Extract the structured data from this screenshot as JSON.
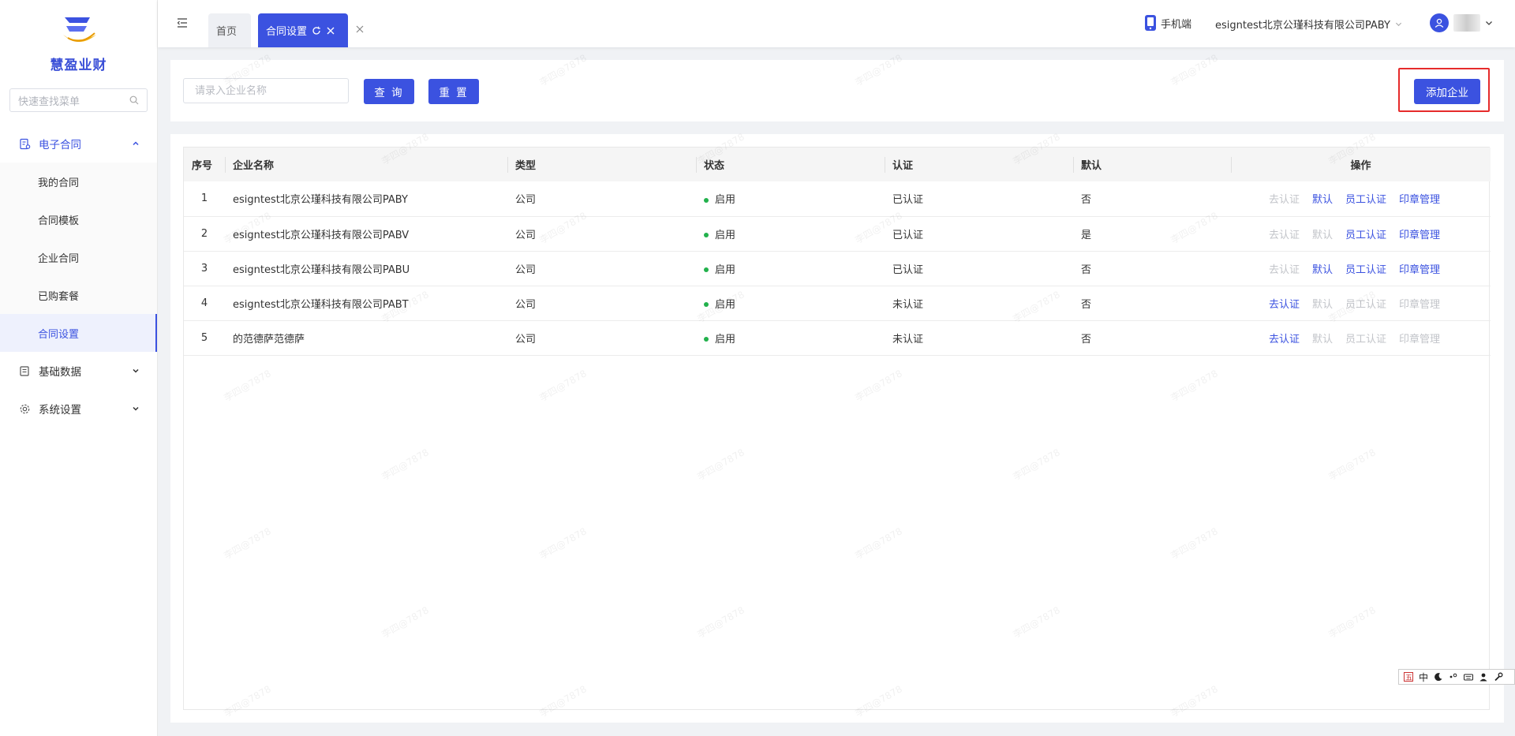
{
  "app": {
    "name": "慧盈业财"
  },
  "sidebar": {
    "search_placeholder": "快速查找菜单",
    "groups": [
      {
        "label": "电子合同",
        "icon": "contract-icon",
        "expanded": true,
        "items": [
          {
            "label": "我的合同"
          },
          {
            "label": "合同模板"
          },
          {
            "label": "企业合同"
          },
          {
            "label": "已购套餐"
          },
          {
            "label": "合同设置",
            "active": true
          }
        ]
      },
      {
        "label": "基础数据",
        "icon": "database-icon",
        "expanded": false
      },
      {
        "label": "系统设置",
        "icon": "gear-icon",
        "expanded": false
      }
    ]
  },
  "header": {
    "tabs": [
      {
        "label": "首页"
      },
      {
        "label": "合同设置",
        "active": true
      }
    ],
    "mobile_label": "手机端",
    "company": "esigntest北京公瑾科技有限公司PABY"
  },
  "search": {
    "placeholder": "请录入企业名称",
    "value": "",
    "query_label": "查 询",
    "reset_label": "重 置",
    "add_label": "添加企业"
  },
  "table": {
    "columns": [
      "序号",
      "企业名称",
      "类型",
      "状态",
      "认证",
      "默认",
      "操作"
    ],
    "action_labels": [
      "去认证",
      "默认",
      "员工认证",
      "印章管理"
    ],
    "rows": [
      {
        "idx": "1",
        "name": "esigntest北京公瑾科技有限公司PABY",
        "type": "公司",
        "status": "启用",
        "cert": "已认证",
        "default": "否",
        "enabled": [
          false,
          true,
          true,
          true
        ]
      },
      {
        "idx": "2",
        "name": "esigntest北京公瑾科技有限公司PABV",
        "type": "公司",
        "status": "启用",
        "cert": "已认证",
        "default": "是",
        "enabled": [
          false,
          false,
          true,
          true
        ]
      },
      {
        "idx": "3",
        "name": "esigntest北京公瑾科技有限公司PABU",
        "type": "公司",
        "status": "启用",
        "cert": "已认证",
        "default": "否",
        "enabled": [
          false,
          true,
          true,
          true
        ]
      },
      {
        "idx": "4",
        "name": "esigntest北京公瑾科技有限公司PABT",
        "type": "公司",
        "status": "启用",
        "cert": "未认证",
        "default": "否",
        "enabled": [
          true,
          false,
          false,
          false
        ]
      },
      {
        "idx": "5",
        "name": "的范德萨范德萨",
        "type": "公司",
        "status": "启用",
        "cert": "未认证",
        "default": "否",
        "enabled": [
          true,
          false,
          false,
          false
        ]
      }
    ]
  },
  "watermark": "李四@7878",
  "ime": {
    "mode": "中"
  },
  "colors": {
    "accent": "#3b52e0",
    "status_green": "#22b14c",
    "highlight_red": "#e62b2b"
  }
}
